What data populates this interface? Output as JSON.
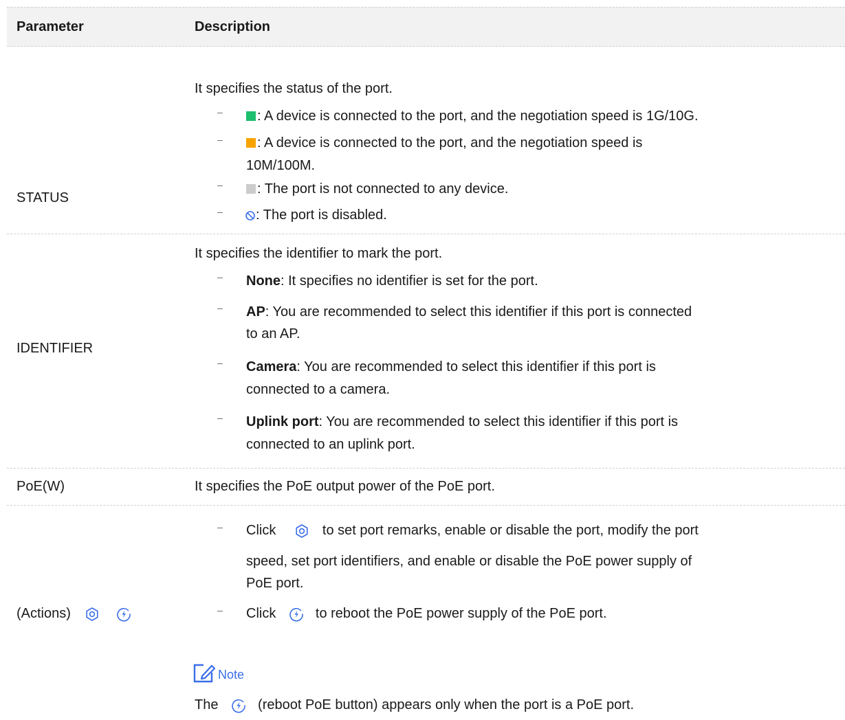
{
  "header": {
    "parameter": "Parameter",
    "description": "Description"
  },
  "colors": {
    "green_status": "#1ebf6f",
    "orange_status": "#f7a400",
    "gray_status": "#cccccc",
    "icon_blue": "#3a6ee8",
    "note_blue": "#3a6ee8"
  },
  "dash_char": "–",
  "status": {
    "name": "STATUS",
    "intro": "It specifies the status of the port.",
    "items": [
      {
        "icon": "green-square",
        "text": ": A device is connected to the port, and the negotiation speed is 1G/10G."
      },
      {
        "icon": "orange-square",
        "text": ": A device is connected to the port, and the negotiation speed is",
        "text2": "10M/100M."
      },
      {
        "icon": "gray-square",
        "text": ": The port is not connected to any device."
      },
      {
        "icon": "disabled-circle-icon",
        "text": ": The port is disabled."
      }
    ]
  },
  "identifier": {
    "name": "IDENTIFIER",
    "intro": "It specifies the identifier to mark the port.",
    "items": [
      {
        "term": "None",
        "text": ": It specifies no identifier is set for the port."
      },
      {
        "term": "AP",
        "text": ": You are recommended to select this identifier if this port is connected",
        "text2": "to an AP."
      },
      {
        "term": "Camera",
        "text": ": You are recommended to select this identifier if this port is",
        "text2": "connected to a camera."
      },
      {
        "term": "Uplink port",
        "text": ": You are recommended to select this identifier if this port is",
        "text2": "connected to an uplink port."
      }
    ]
  },
  "poe": {
    "name": "PoE(W)",
    "desc": "It specifies the PoE output power of the PoE port."
  },
  "actions": {
    "name": "(Actions)",
    "items": [
      {
        "click": "Click",
        "icon": "settings-gear-icon",
        "line1": "to set port remarks, enable or disable the port, modify the port",
        "line2": "speed, set port identifiers, and enable or disable the PoE power supply of",
        "line3": "PoE port."
      },
      {
        "click": "Click",
        "icon": "reboot-poe-icon",
        "line1": "to reboot the PoE power supply of the PoE port."
      }
    ],
    "note_label": "Note",
    "note_pre": "The",
    "note_post": "(reboot PoE button) appears only when the port is a PoE port."
  }
}
